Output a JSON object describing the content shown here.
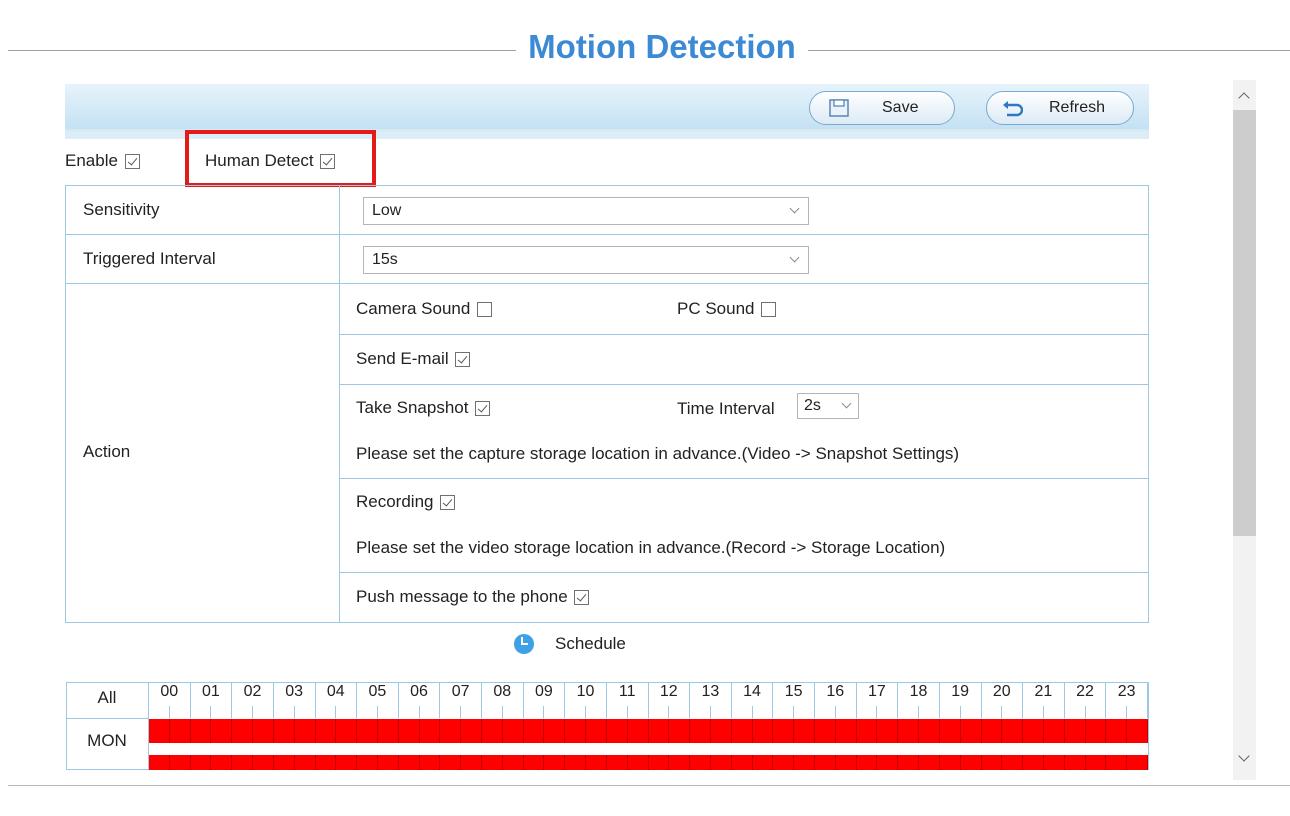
{
  "page": {
    "title": "Motion Detection"
  },
  "toolbar": {
    "save_label": "Save",
    "refresh_label": "Refresh"
  },
  "options": {
    "enable": {
      "label": "Enable",
      "checked": true
    },
    "human_detect": {
      "label": "Human Detect",
      "checked": true
    }
  },
  "settings": {
    "sensitivity": {
      "label": "Sensitivity",
      "value": "Low"
    },
    "triggered_interval": {
      "label": "Triggered Interval",
      "value": "15s"
    },
    "action": {
      "label": "Action",
      "camera_sound": {
        "label": "Camera Sound",
        "checked": false
      },
      "pc_sound": {
        "label": "PC Sound",
        "checked": false
      },
      "send_email": {
        "label": "Send E-mail",
        "checked": true
      },
      "take_snapshot": {
        "label": "Take Snapshot",
        "checked": true
      },
      "time_interval": {
        "label": "Time Interval",
        "value": "2s"
      },
      "snapshot_note": "Please set the capture storage location in advance.(Video -> Snapshot Settings)",
      "recording": {
        "label": "Recording",
        "checked": true
      },
      "recording_note": "Please set the video storage location in advance.(Record -> Storage Location)",
      "push_message": {
        "label": "Push message to the phone",
        "checked": true
      }
    }
  },
  "schedule": {
    "label": "Schedule",
    "all_label": "All",
    "hours": [
      "00",
      "01",
      "02",
      "03",
      "04",
      "05",
      "06",
      "07",
      "08",
      "09",
      "10",
      "11",
      "12",
      "13",
      "14",
      "15",
      "16",
      "17",
      "18",
      "19",
      "20",
      "21",
      "22",
      "23"
    ],
    "days": [
      "MON"
    ],
    "active_color": "#ff0000"
  },
  "colors": {
    "accent": "#3c8ad6",
    "highlight_box": "#e21b1b",
    "table_border": "#9cc8e3"
  }
}
